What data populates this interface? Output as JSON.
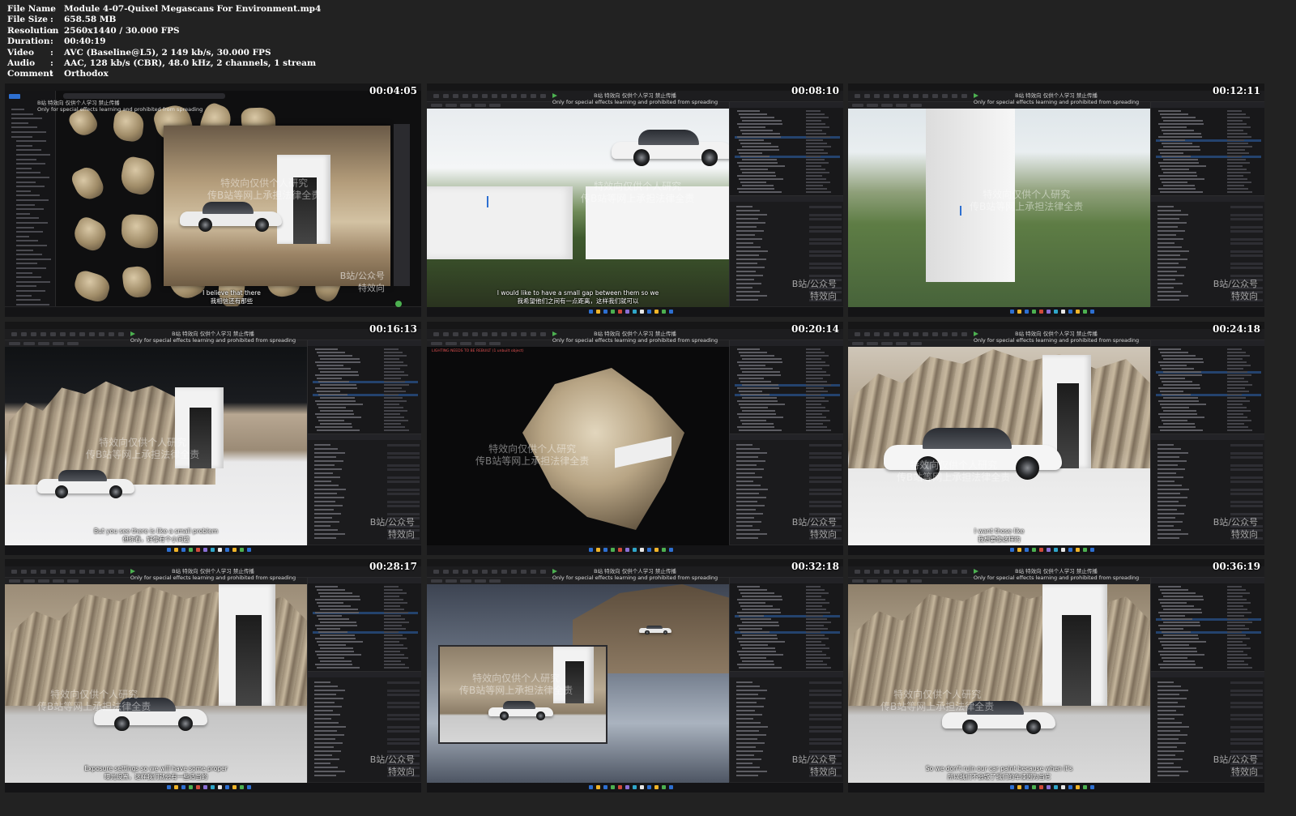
{
  "file_info": [
    {
      "key": "File Name",
      "value": "Module 4-07-Quixel Megascans For Environment.mp4"
    },
    {
      "key": "File Size",
      "value": "658.58 MB"
    },
    {
      "key": "Resolution",
      "value": "2560x1440 / 30.000 FPS"
    },
    {
      "key": "Duration",
      "value": "00:40:19"
    },
    {
      "key": "Video",
      "value": "AVC (Baseline@L5), 2 149 kb/s, 30.000 FPS"
    },
    {
      "key": "Audio",
      "value": "AAC, 128 kb/s (CBR), 48.0 kHz, 2 channels, 1 stream"
    },
    {
      "key": "Comment",
      "value": "Orthodox"
    }
  ],
  "separator": ":",
  "watermark": {
    "top_cn": "B站 特效向 仅供个人学习 禁止传播",
    "top_en": "Only for special effects learning and prohibited from spreading",
    "center_line1": "特效向仅供个人研究",
    "center_line2": "传B站等网上承担法律全责",
    "corner_line1": "B站/公众号",
    "corner_line2": "特效向"
  },
  "thumbnails": [
    {
      "timestamp": "00:04:05",
      "subtitle_en": "I believe that there",
      "subtitle_cn": "我相信还有那些"
    },
    {
      "timestamp": "00:08:10",
      "subtitle_en": "I would like to have a small gap between them so we",
      "subtitle_cn": "我希望他们之间有一点距离，这样我们就可以"
    },
    {
      "timestamp": "00:12:11",
      "subtitle_en": "",
      "subtitle_cn": ""
    },
    {
      "timestamp": "00:16:13",
      "subtitle_en": "But you see there is like a small problem",
      "subtitle_cn": "但你看，好像有个小问题",
      "warning": "LIGHTING NEEDS TO BE REBUILT (1 unbuilt object)"
    },
    {
      "timestamp": "00:20:14",
      "subtitle_en": "",
      "subtitle_cn": ""
    },
    {
      "timestamp": "00:24:18",
      "subtitle_en": "I want those like",
      "subtitle_cn": "我想要像这样的"
    },
    {
      "timestamp": "00:28:17",
      "subtitle_en": "Exposure settings so we will have some proper",
      "subtitle_cn": "曝光设置，这样我们就会有一些适当的"
    },
    {
      "timestamp": "00:32:18",
      "subtitle_en": "",
      "subtitle_cn": ""
    },
    {
      "timestamp": "00:36:19",
      "subtitle_en": "So we don't ruin our car paint because when it's",
      "subtitle_cn": "所以我们不会毁了我们的车漆因为当它"
    }
  ],
  "colors": {
    "background": "#222222",
    "selection": "#24436e",
    "accent_blue": "#2d6fd1",
    "warning_red": "#e05050"
  }
}
